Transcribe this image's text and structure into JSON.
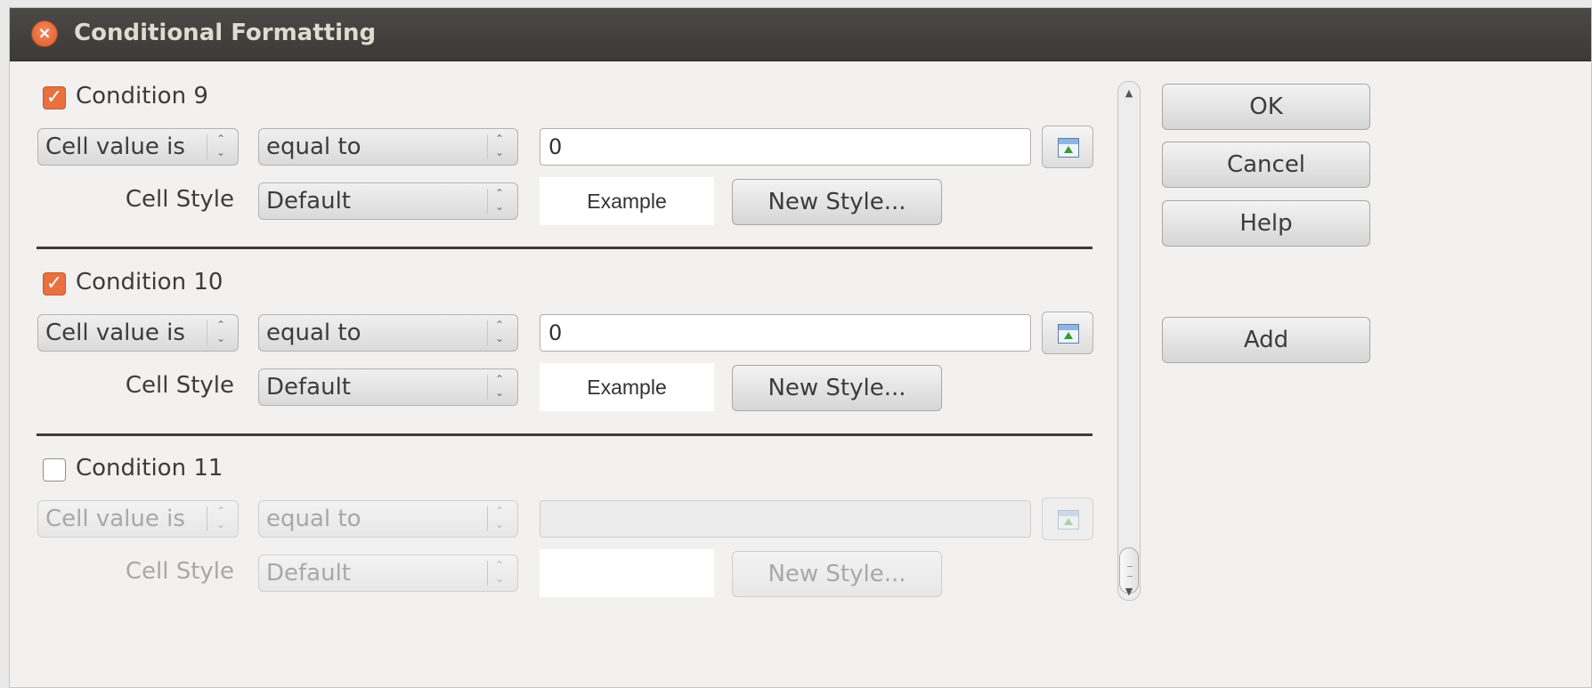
{
  "window": {
    "title": "Conditional Formatting",
    "close_glyph": "×"
  },
  "conditions": [
    {
      "label": "Condition 9",
      "checked": true,
      "checkmark": "✓",
      "type": "Cell value is",
      "operator": "equal to",
      "value": "0",
      "cell_style_label": "Cell Style",
      "style": "Default",
      "example": "Example",
      "new_style_label": "New Style...",
      "enabled": true
    },
    {
      "label": "Condition 10",
      "checked": true,
      "checkmark": "✓",
      "type": "Cell value is",
      "operator": "equal to",
      "value": "0",
      "cell_style_label": "Cell Style",
      "style": "Default",
      "example": "Example",
      "new_style_label": "New Style...",
      "enabled": true
    },
    {
      "label": "Condition 11",
      "checked": false,
      "checkmark": "",
      "type": "Cell value is",
      "operator": "equal to",
      "value": "",
      "cell_style_label": "Cell Style",
      "style": "Default",
      "example": "",
      "new_style_label": "New Style...",
      "enabled": false
    }
  ],
  "combo_arrows": "⌃\n⌄",
  "buttons": {
    "ok": "OK",
    "cancel": "Cancel",
    "help": "Help",
    "add": "Add"
  },
  "scrollbar": {
    "up": "▲",
    "down": "▼"
  },
  "colors": {
    "accent": "#e9703f",
    "titlebar": "#3c3b37",
    "dialog_bg": "#f2f1f0"
  },
  "icons": {
    "shrink": "shrink-range-icon",
    "close": "close-icon"
  }
}
